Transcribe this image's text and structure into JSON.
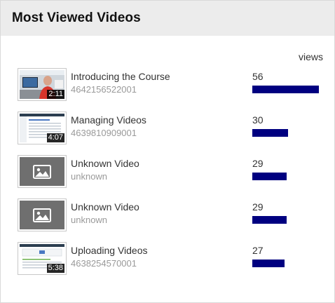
{
  "header": {
    "title": "Most Viewed Videos"
  },
  "columns": {
    "views_label": "views"
  },
  "max_views": 56,
  "videos": [
    {
      "name": "Introducing the Course",
      "id": "4642156522001",
      "views": "56",
      "views_num": 56,
      "duration": "2:11",
      "thumb": "person"
    },
    {
      "name": "Managing Videos",
      "id": "4639810909001",
      "views": "30",
      "views_num": 30,
      "duration": "4:07",
      "thumb": "screen"
    },
    {
      "name": "Unknown Video",
      "id": "unknown",
      "views": "29",
      "views_num": 29,
      "duration": "",
      "thumb": "placeholder-image-icon"
    },
    {
      "name": "Unknown Video",
      "id": "unknown",
      "views": "29",
      "views_num": 29,
      "duration": "",
      "thumb": "placeholder-image-icon"
    },
    {
      "name": "Uploading Videos",
      "id": "4638254570001",
      "views": "27",
      "views_num": 27,
      "duration": "5:38",
      "thumb": "screen-form"
    }
  ],
  "colors": {
    "bar": "#000080",
    "header_bg": "#ececec"
  }
}
